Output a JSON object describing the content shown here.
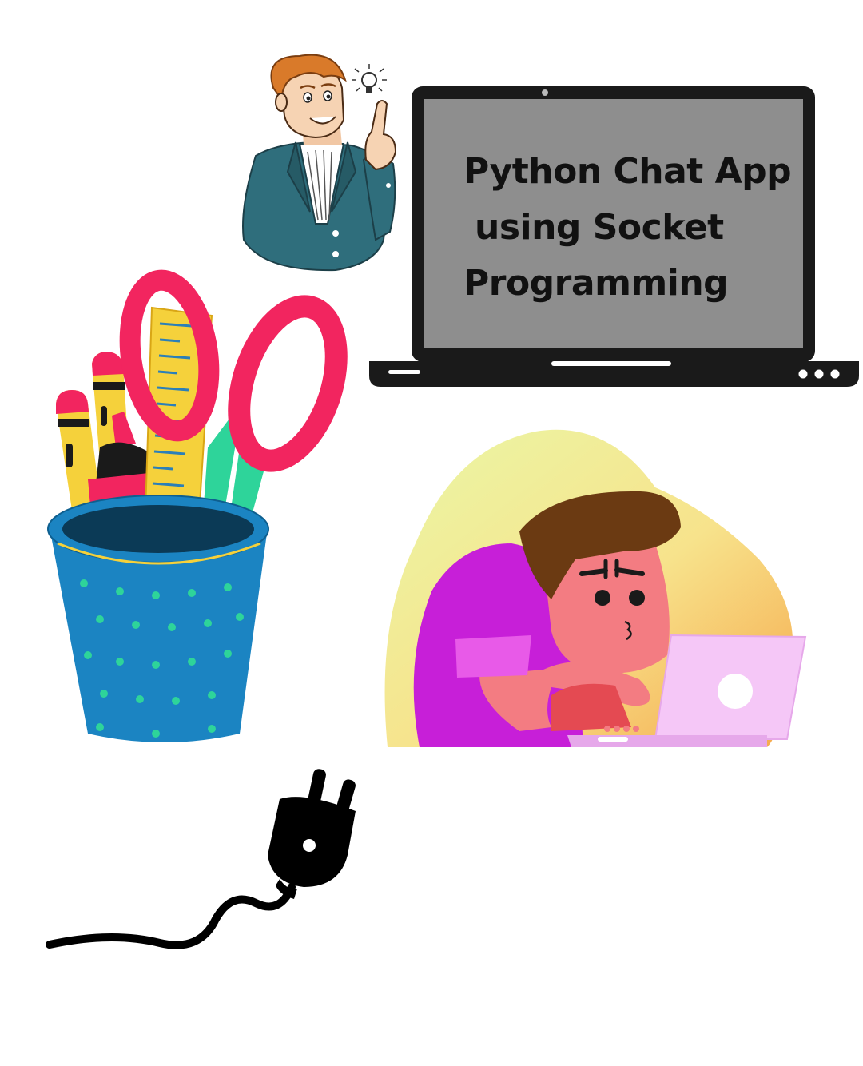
{
  "title": {
    "line1": "Python Chat App",
    "line2": "using Socket",
    "line3": "Programming"
  },
  "colors": {
    "background": "#ffffff",
    "laptop_frame": "#1a1a1a",
    "laptop_screen": "#8e8e8e",
    "scissors": "#f2255f",
    "ruler": "#f5d13b",
    "cup": "#1b84c2",
    "cup_dots": "#2ed49a",
    "hoodie": "#c71fd8",
    "skin": "#f37c82",
    "hair": "#6b3a12",
    "small_laptop": "#f5c7f7",
    "jacket": "#2f6e7c",
    "plug": "#000000"
  },
  "icons": [
    "laptop-icon",
    "lightbulb-icon",
    "pencil-cup-icon",
    "scissors-icon",
    "ruler-icon",
    "power-plug-icon"
  ]
}
